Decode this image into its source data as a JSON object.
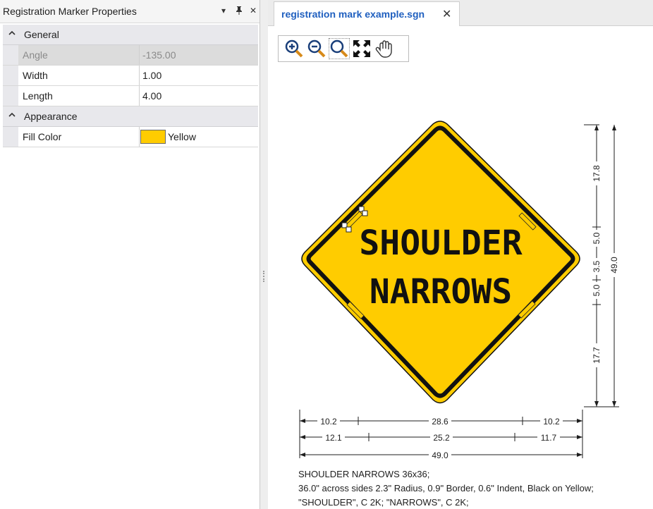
{
  "panel": {
    "title": "Registration Marker Properties",
    "controls": {
      "dropdown": "▾",
      "pin": "📌",
      "close": "✕"
    },
    "categories": [
      {
        "label": "General",
        "properties": [
          {
            "name": "Angle",
            "value": "-135.00"
          },
          {
            "name": "Width",
            "value": "1.00"
          },
          {
            "name": "Length",
            "value": "4.00"
          }
        ]
      },
      {
        "label": "Appearance",
        "properties": [
          {
            "name": "Fill Color",
            "value": "Yellow",
            "color": "#ffcc00"
          }
        ]
      }
    ]
  },
  "document": {
    "tab": {
      "label": "registration mark example.sgn",
      "close": "✕"
    },
    "toolbar": {
      "items": [
        {
          "name": "zoom-in",
          "icon": "zoom-in-icon"
        },
        {
          "name": "zoom-out",
          "icon": "zoom-out-icon"
        },
        {
          "name": "zoom-window",
          "icon": "zoom-window-icon"
        },
        {
          "name": "zoom-extents",
          "icon": "fit-icon"
        },
        {
          "name": "pan",
          "icon": "hand-icon"
        }
      ]
    },
    "sign": {
      "line1": "SHOULDER",
      "line2": "NARROWS",
      "fill_color": "#ffcc00",
      "border_color": "#111111"
    },
    "dimensions": {
      "vertical": [
        "17.8",
        "5.0",
        "3.5",
        "5.0",
        "17.7"
      ],
      "vertical_total": "49.0",
      "row1": [
        "10.2",
        "28.6",
        "10.2"
      ],
      "row2": [
        "12.1",
        "25.2",
        "11.7"
      ],
      "total": "49.0"
    },
    "description": [
      "SHOULDER NARROWS 36x36;",
      "36.0\" across sides 2.3\" Radius, 0.9\" Border, 0.6\" Indent, Black on Yellow;",
      "\"SHOULDER\",  C 2K; \"NARROWS\",  C 2K;"
    ]
  }
}
